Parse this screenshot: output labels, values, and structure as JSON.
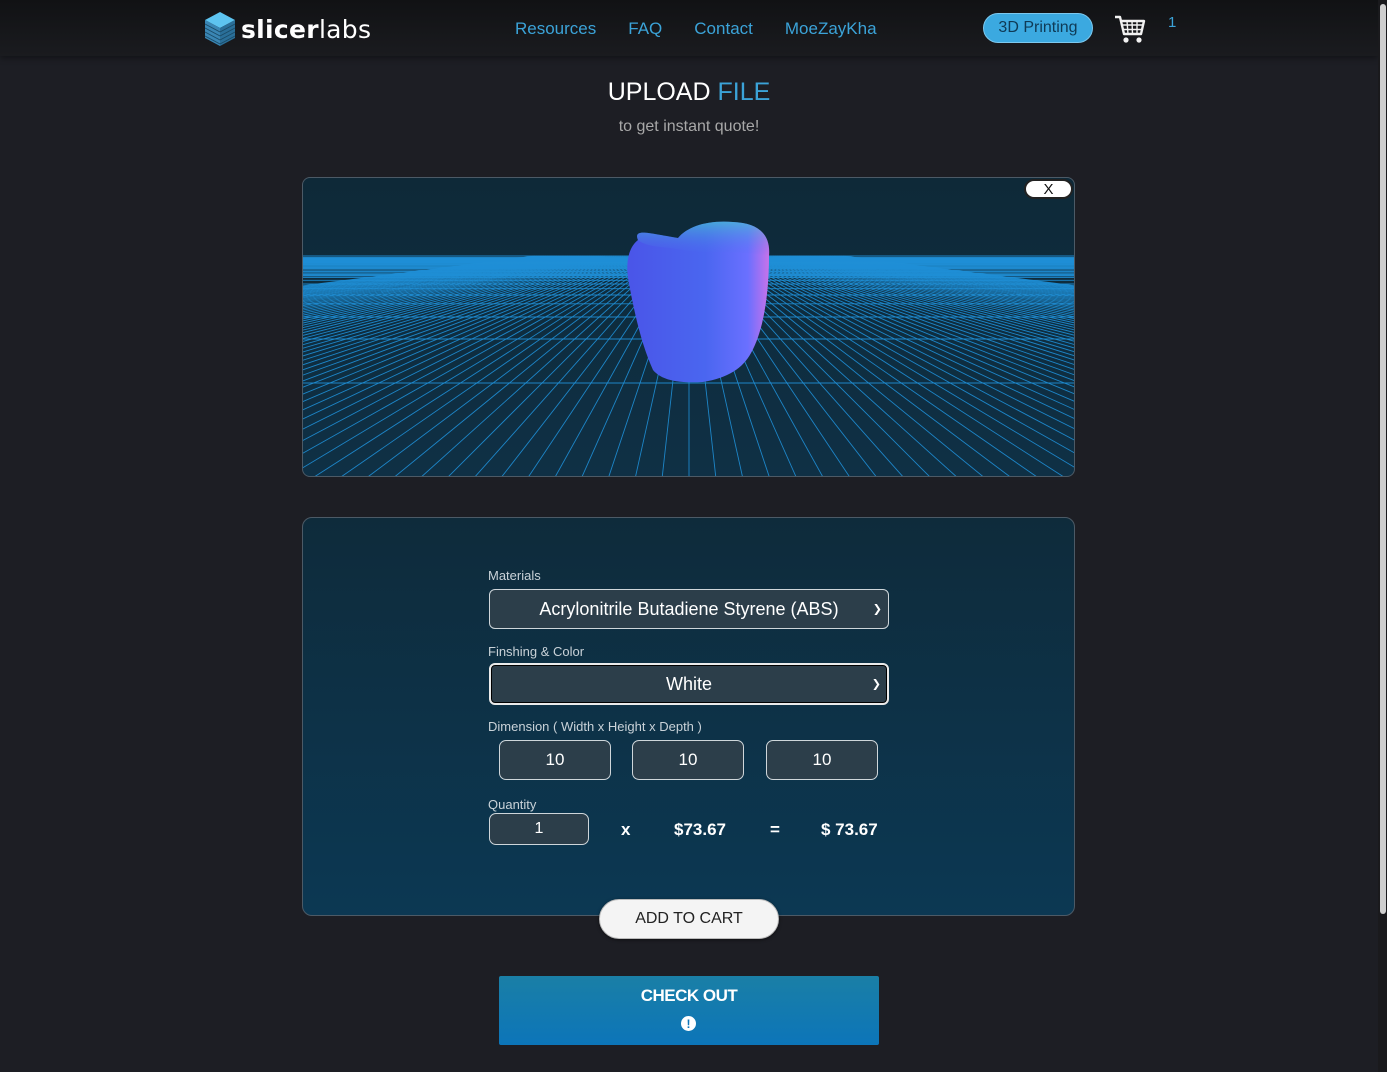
{
  "nav": {
    "brand": {
      "prefix": "slicer",
      "suffix": "labs"
    },
    "links": [
      "Resources",
      "FAQ",
      "Contact",
      "MoeZayKha"
    ],
    "service_pill": "3D Printing",
    "cart_count": "1",
    "cart_icon": "shopping-cart-icon"
  },
  "header": {
    "title_main": "UPLOAD",
    "title_accent": "FILE",
    "subtitle": "to get instant quote!"
  },
  "viewer": {
    "close_label": "X"
  },
  "options": {
    "materials_label": "Materials",
    "material_value": "Acrylonitrile Butadiene Styrene (ABS)",
    "finishing_label": "Finshing & Color",
    "finishing_value": "White",
    "dimension_label": "Dimension ( Width x Height x Depth )",
    "width": "10",
    "height": "10",
    "depth": "10",
    "quantity_label": "Quantity",
    "quantity": "1",
    "multiply_sign": "x",
    "unit_price": "$73.67",
    "equals_sign": "=",
    "total_price": "$ 73.67"
  },
  "actions": {
    "add_to_cart": "ADD TO CART",
    "checkout": "CHECK OUT",
    "checkout_icon": "alert-circle-icon"
  },
  "colors": {
    "accent": "#3ba3d8",
    "background": "#1d1e24",
    "panel": "#0e2b3b",
    "checkout": "#0c75b9"
  }
}
